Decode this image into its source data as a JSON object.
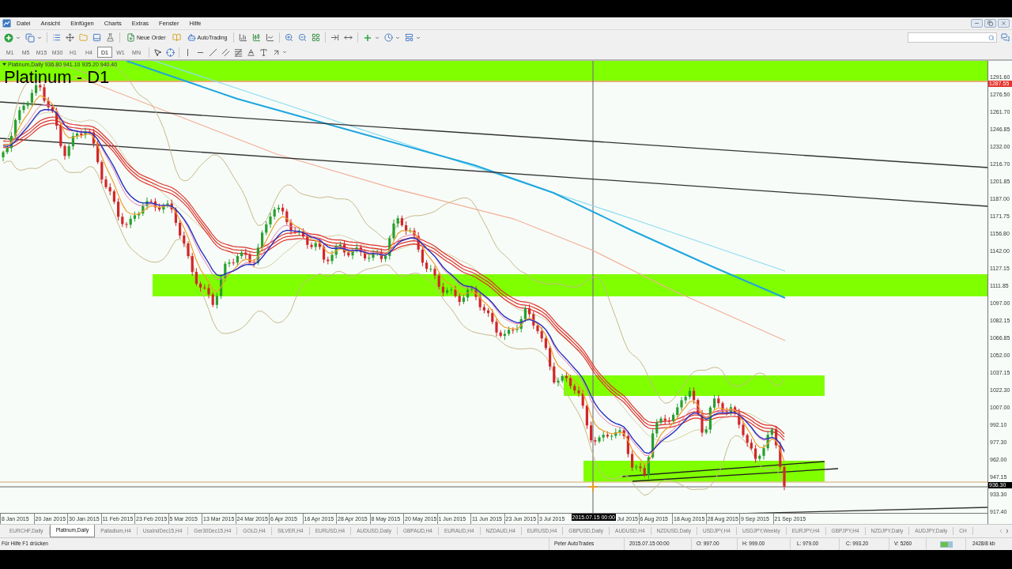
{
  "menu": [
    "Datei",
    "Ansicht",
    "Einfügen",
    "Charts",
    "Extras",
    "Fenster",
    "Hilfe"
  ],
  "toolbar": {
    "new_order": "Neue Order",
    "autotrading": "AutoTrading"
  },
  "timeframes": [
    {
      "label": "M1",
      "selected": false
    },
    {
      "label": "M5",
      "selected": false
    },
    {
      "label": "M15",
      "selected": false
    },
    {
      "label": "M30",
      "selected": false
    },
    {
      "label": "H1",
      "selected": false
    },
    {
      "label": "H4",
      "selected": false
    },
    {
      "label": "D1",
      "selected": true
    },
    {
      "label": "W1",
      "selected": false
    },
    {
      "label": "MN",
      "selected": false
    }
  ],
  "chart": {
    "info": "Platinum,Daily 936.80 941.10 935.20 940.40",
    "title": "Platinum - D1",
    "price_axis": [
      "1291.60",
      "1276.50",
      "1261.70",
      "1246.85",
      "1232.00",
      "1216.70",
      "1201.85",
      "1187.00",
      "1171.75",
      "1156.80",
      "1142.00",
      "1127.15",
      "1111.85",
      "1097.00",
      "1082.15",
      "1066.85",
      "1052.00",
      "1037.15",
      "1022.30",
      "1007.00",
      "992.10",
      "977.30",
      "962.00",
      "947.15",
      "933.30",
      "917.40"
    ],
    "price_markers": [
      {
        "label": "1287.55",
        "color": "#e8322c"
      },
      {
        "label": "936.30",
        "color": "#000000"
      }
    ],
    "time_axis": [
      {
        "label": "8 Jan 2015",
        "kind": "tick"
      },
      {
        "label": "20 Jan 2015",
        "kind": "tick"
      },
      {
        "label": "30 Jan 2015",
        "kind": "tick"
      },
      {
        "label": "11 Feb 2015",
        "kind": "tick"
      },
      {
        "label": "23 Feb 2015",
        "kind": "tick"
      },
      {
        "label": "5 Mar 2015",
        "kind": "tick"
      },
      {
        "label": "13 Mar 2015",
        "kind": "tick"
      },
      {
        "label": "24 Mar 2015",
        "kind": "tick"
      },
      {
        "label": "6 Apr 2015",
        "kind": "tick"
      },
      {
        "label": "16 Apr 2015",
        "kind": "tick"
      },
      {
        "label": "28 Apr 2015",
        "kind": "tick"
      },
      {
        "label": "8 May 2015",
        "kind": "tick"
      },
      {
        "label": "20 May 2015",
        "kind": "tick"
      },
      {
        "label": "1 Jun 2015",
        "kind": "tick"
      },
      {
        "label": "11 Jun 2015",
        "kind": "tick"
      },
      {
        "label": "23 Jun 2015",
        "kind": "tick"
      },
      {
        "label": "3 Jul 2015",
        "kind": "tick"
      },
      {
        "label": "2015.07.15 00:00",
        "kind": "crosshair"
      },
      {
        "label": "Jul 2015",
        "kind": "cut"
      },
      {
        "label": "6 Aug 2015",
        "kind": "tick"
      },
      {
        "label": "18 Aug 2015",
        "kind": "tick"
      },
      {
        "label": "28 Aug 2015",
        "kind": "tick"
      },
      {
        "label": "9 Sep 2015",
        "kind": "tick"
      },
      {
        "label": "21 Sep 2015",
        "kind": "tick"
      }
    ]
  },
  "tabs": [
    {
      "label": "EURCHF,Daily",
      "selected": false
    },
    {
      "label": "Platinum,Daily",
      "selected": true
    },
    {
      "label": "Palladium,H4",
      "selected": false
    },
    {
      "label": "UsaIndDec15,H4",
      "selected": false
    },
    {
      "label": "Ger30Dec15,H4",
      "selected": false
    },
    {
      "label": "GOLD,H4",
      "selected": false
    },
    {
      "label": "SILVER,H4",
      "selected": false
    },
    {
      "label": "EURUSD,H4",
      "selected": false
    },
    {
      "label": "AUDUSD,Daily",
      "selected": false
    },
    {
      "label": "GBPAUD,H4",
      "selected": false
    },
    {
      "label": "EURAUD,H4",
      "selected": false
    },
    {
      "label": "NZDAUD,H4",
      "selected": false
    },
    {
      "label": "EURUSD,H4",
      "selected": false
    },
    {
      "label": "GBPUSD,Daily",
      "selected": false
    },
    {
      "label": "AUDUSD,H4",
      "selected": false
    },
    {
      "label": "NZDUSD,Daily",
      "selected": false
    },
    {
      "label": "USDJPY,H4",
      "selected": false
    },
    {
      "label": "USDJPY,Weekly",
      "selected": false
    },
    {
      "label": "EURJPY,H4",
      "selected": false
    },
    {
      "label": "GBPJPY,H4",
      "selected": false
    },
    {
      "label": "NZDJPY,Daily",
      "selected": false
    },
    {
      "label": "AUDJPY,Daily",
      "selected": false
    },
    {
      "label": "CH",
      "selected": false
    }
  ],
  "status_bar": {
    "help": "Für Hilfe F1 drücken",
    "profile": "Peter AutoTrades",
    "time": "2015.07.15 00:00",
    "open": "O: 997.00",
    "high": "H: 999.00",
    "low": "L: 979.00",
    "close": "C: 993.20",
    "volume": "V: 5260",
    "traffic": "2428/8 kb"
  }
}
